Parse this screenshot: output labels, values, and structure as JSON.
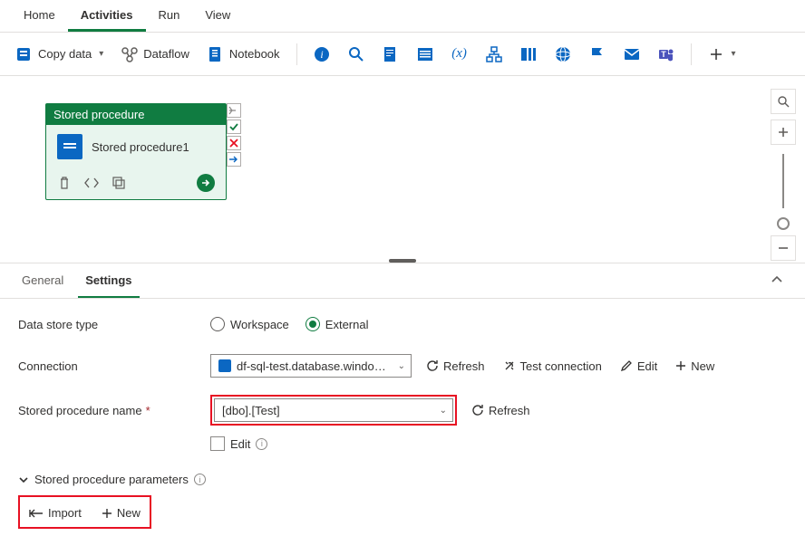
{
  "topTabs": {
    "home": "Home",
    "activities": "Activities",
    "run": "Run",
    "view": "View"
  },
  "toolbar": {
    "copyData": "Copy data",
    "dataflow": "Dataflow",
    "notebook": "Notebook"
  },
  "activity": {
    "header": "Stored procedure",
    "name": "Stored procedure1"
  },
  "panelTabs": {
    "general": "General",
    "settings": "Settings"
  },
  "form": {
    "dataStoreTypeLabel": "Data store type",
    "workspace": "Workspace",
    "external": "External",
    "connectionLabel": "Connection",
    "connectionValue": "df-sql-test.database.windows.net;tes...",
    "refresh": "Refresh",
    "testConnection": "Test connection",
    "edit": "Edit",
    "new": "New",
    "spNameLabel": "Stored procedure name",
    "spNameValue": "[dbo].[Test]",
    "editCheck": "Edit",
    "paramsHeader": "Stored procedure parameters",
    "import": "Import"
  }
}
